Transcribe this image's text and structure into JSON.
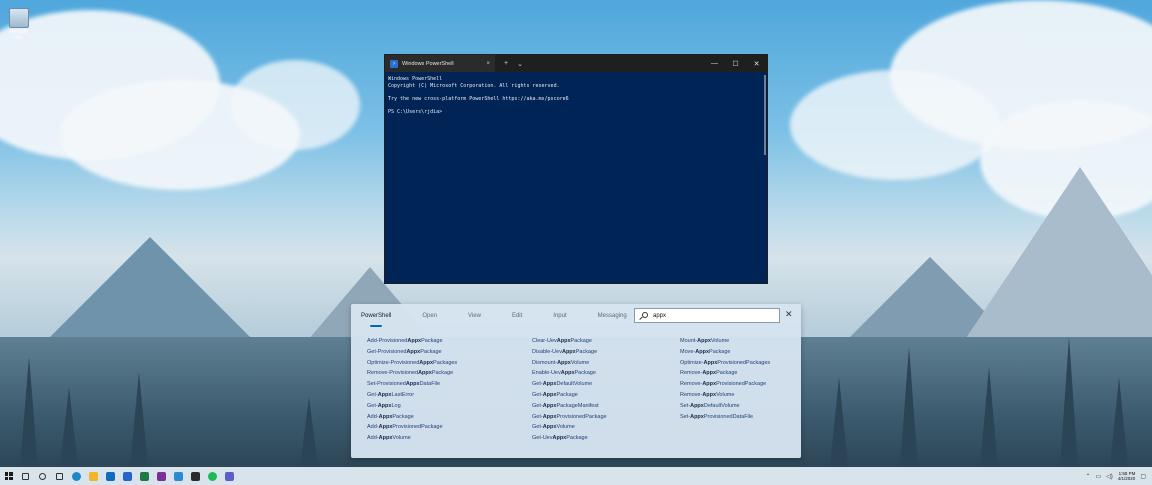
{
  "desktop": {
    "recycle_bin_label": "Recycle Bin"
  },
  "terminal": {
    "tab_title": "Windows PowerShell",
    "tab_close": "×",
    "new_tab": "+",
    "dropdown": "⌄",
    "minimize": "—",
    "maximize": "☐",
    "close": "✕",
    "lines": [
      "Windows PowerShell",
      "Copyright (C) Microsoft Corporation. All rights reserved.",
      "",
      "Try the new cross-platform PowerShell https://aka.ms/pscore6",
      "",
      "PS C:\\Users\\rjdia>"
    ]
  },
  "panel": {
    "tabs": [
      "PowerShell",
      "Open",
      "View",
      "Edit",
      "Input",
      "Messaging"
    ],
    "active_tab": "PowerShell",
    "search_value": "appx",
    "close": "✕",
    "results": [
      [
        [
          "Add-Provisioned",
          "Appx",
          "Package"
        ],
        [
          "Get-Provisioned",
          "Appx",
          "Package"
        ],
        [
          "Optimize-Provisioned",
          "Appx",
          "Packages"
        ],
        [
          "Remove-Provisioned",
          "Appx",
          "Package"
        ],
        [
          "Set-Provisioned",
          "Appx",
          "DataFile"
        ],
        [
          "Get-",
          "Appx",
          "LastError"
        ],
        [
          "Get-",
          "Appx",
          "Log"
        ],
        [
          "Add-",
          "Appx",
          "Package"
        ],
        [
          "Add-",
          "Appx",
          "ProvisionedPackage"
        ],
        [
          "Add-",
          "Appx",
          "Volume"
        ]
      ],
      [
        [
          "Clear-Uev",
          "Appx",
          "Package"
        ],
        [
          "Disable-Uev",
          "Appx",
          "Package"
        ],
        [
          "Dismount-",
          "Appx",
          "Volume"
        ],
        [
          "Enable-Uev",
          "Appx",
          "Package"
        ],
        [
          "Get-",
          "Appx",
          "DefaultVolume"
        ],
        [
          "Get-",
          "Appx",
          "Package"
        ],
        [
          "Get-",
          "Appx",
          "PackageManifest"
        ],
        [
          "Get-",
          "Appx",
          "ProvisionedPackage"
        ],
        [
          "Get-",
          "Appx",
          "Volume"
        ],
        [
          "Get-Uev",
          "Appx",
          "Package"
        ]
      ],
      [
        [
          "Mount-",
          "Appx",
          "Volume"
        ],
        [
          "Move-",
          "Appx",
          "Package"
        ],
        [
          "Optimize-",
          "Appx",
          "ProvisionedPackages"
        ],
        [
          "Remove-",
          "Appx",
          "Package"
        ],
        [
          "Remove-",
          "Appx",
          "ProvisionedPackage"
        ],
        [
          "Remove-",
          "Appx",
          "Volume"
        ],
        [
          "Set-",
          "Appx",
          "DefaultVolume"
        ],
        [
          "Set-",
          "Appx",
          "ProvisionedDataFile"
        ]
      ]
    ]
  },
  "taskbar": {
    "apps": [
      {
        "name": "search-icon",
        "color": "#333333"
      },
      {
        "name": "cortana-icon",
        "color": "#333333"
      },
      {
        "name": "task-view-icon",
        "color": "#333333"
      },
      {
        "name": "edge-icon",
        "color": "#1e88c7"
      },
      {
        "name": "file-explorer-icon",
        "color": "#f2b428"
      },
      {
        "name": "mail-icon",
        "color": "#0f6cbd"
      },
      {
        "name": "todo-icon",
        "color": "#2564cf"
      },
      {
        "name": "excel-icon",
        "color": "#1d7a45"
      },
      {
        "name": "onenote-icon",
        "color": "#7a2f9a"
      },
      {
        "name": "vscode-icon",
        "color": "#2a8ad4"
      },
      {
        "name": "terminal-icon",
        "color": "#2b2b2b"
      },
      {
        "name": "spotify-icon",
        "color": "#1db954"
      },
      {
        "name": "teams-icon",
        "color": "#5b5fc7"
      }
    ],
    "time": "1:58 PM",
    "date": "4/1/2020"
  }
}
